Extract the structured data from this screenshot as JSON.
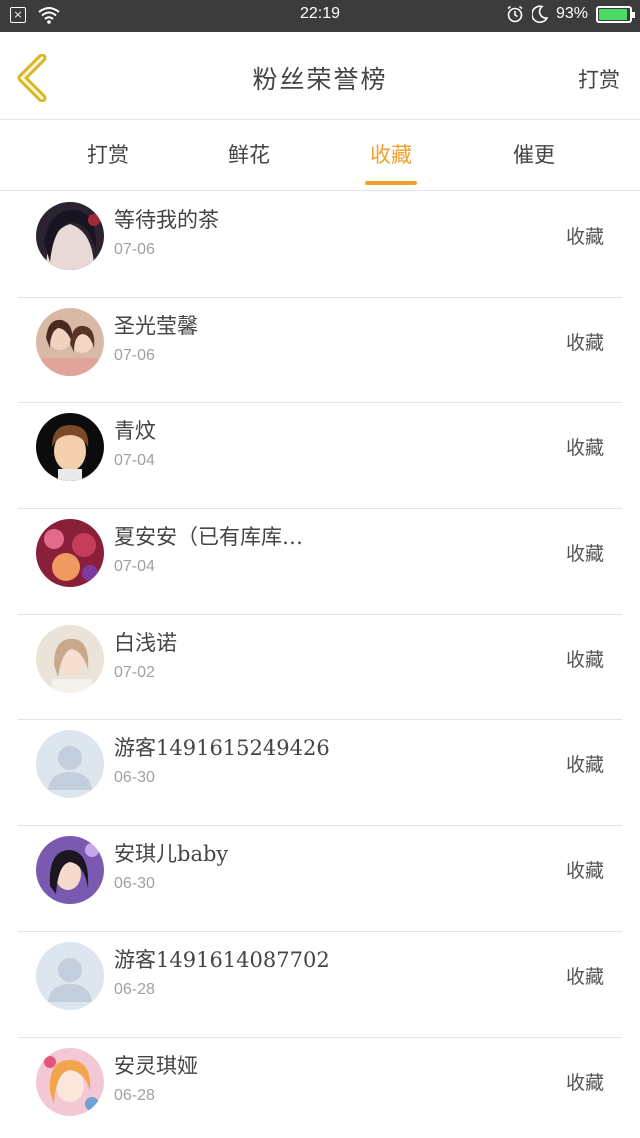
{
  "status_bar": {
    "time": "22:19",
    "battery": "93%",
    "sim_icon": "sim-x-icon",
    "wifi_icon": "wifi-icon",
    "alarm_icon": "alarm-icon",
    "moon_icon": "moon-icon",
    "battery_level": 0.93
  },
  "header": {
    "back_icon": "chevron-left-icon",
    "title": "粉丝荣誉榜",
    "action": "打赏"
  },
  "tabs": [
    {
      "label": "打赏",
      "active": false
    },
    {
      "label": "鲜花",
      "active": false
    },
    {
      "label": "收藏",
      "active": true
    },
    {
      "label": "催更",
      "active": false
    }
  ],
  "accent_color": "#f0a02c",
  "fans": [
    {
      "name": "等待我的茶",
      "date": "07-06",
      "type": "收藏",
      "avatar": "avatar-anime-man"
    },
    {
      "name": "圣光莹馨",
      "date": "07-06",
      "type": "收藏",
      "avatar": "avatar-photo-girls"
    },
    {
      "name": "青炆",
      "date": "07-04",
      "type": "收藏",
      "avatar": "avatar-cartoon-boy"
    },
    {
      "name": "夏安安（已有库库…",
      "date": "07-04",
      "type": "收藏",
      "avatar": "avatar-colorful"
    },
    {
      "name": "白浅诺",
      "date": "07-02",
      "type": "收藏",
      "avatar": "avatar-photo-girl"
    },
    {
      "name": "游客1491615249426",
      "date": "06-30",
      "type": "收藏",
      "avatar": "avatar-default"
    },
    {
      "name": "安琪儿baby",
      "date": "06-30",
      "type": "收藏",
      "avatar": "avatar-photo-purple"
    },
    {
      "name": "游客1491614087702",
      "date": "06-28",
      "type": "收藏",
      "avatar": "avatar-default"
    },
    {
      "name": "安灵琪娅",
      "date": "06-28",
      "type": "收藏",
      "avatar": "avatar-anime-girl"
    }
  ]
}
